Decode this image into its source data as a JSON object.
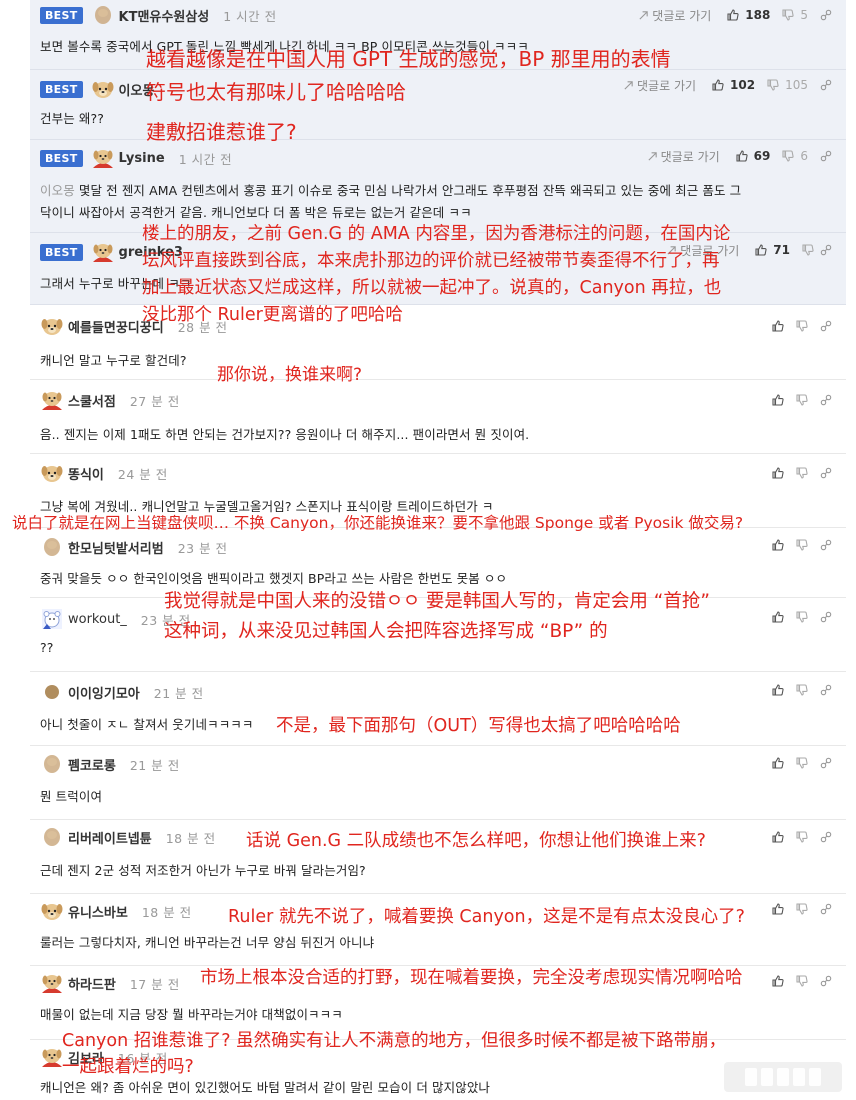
{
  "reply_label": "댓글로 가기",
  "comments": [
    {
      "best": "BEST",
      "nick": "KT맨유수원삼성",
      "time": "1 시간 전",
      "up": "188",
      "down": "5",
      "text": "보면 볼수록 중국에서 GPT 돌린 느낌 빡세게 나긴 하네 ㅋㅋ BP 이모티콘 쓰는것들이 ㅋㅋㅋ"
    },
    {
      "best": "BEST",
      "nick": "이오몽",
      "time": "",
      "up": "102",
      "down": "105",
      "text": "건부는 왜??"
    },
    {
      "best": "BEST",
      "nick": "Lysine",
      "time": "1 시간 전",
      "up": "69",
      "down": "6",
      "mention": "이오몽",
      "text": " 몇달 전 젠지 AMA 컨텐츠에서 홍콩 표기 이슈로 중국 민심 나락가서 안그래도 후푸평점 잔뜩 왜곡되고 있는 중에 최근 폼도 그",
      "text2": "닥이니 싸잡아서 공격한거 같음. 캐니언보다 더 폼 박은 듀로는 없는거 같은데 ㅋㅋ"
    },
    {
      "best": "BEST",
      "nick": "greinke3",
      "time": "",
      "up": "71",
      "down": "",
      "text": "그래서 누구로 바꾸는데 ㅋㅋ"
    },
    {
      "nick": "예를들면꿍디꿍디",
      "time": "28 분 전",
      "text": "캐니언 말고 누구로 할건데?"
    },
    {
      "nick": "스쿨서점",
      "time": "27 분 전",
      "text": "음.. 젠지는 이제 1패도 하면 안되는 건가보지?? 응원이나 더 해주지... 팬이라면서 뭔 짓이여."
    },
    {
      "nick": "똥식이",
      "time": "24 분 전",
      "text": "그냥 복에 겨웠네.. 캐니언말고 누굴델고올거임? 스폰지나 표식이랑 트레이드하던가 ㅋ"
    },
    {
      "nick": "한모님텃밭서리범",
      "time": "23 분 전",
      "text": "중궈 맞을듯 ㅇㅇ 한국인이엇음 밴픽이라고 했겟지 BP라고 쓰는 사람은 한번도 못봄 ㅇㅇ"
    },
    {
      "nick": "workout_",
      "time": "23 분 전",
      "text": "??"
    },
    {
      "nick": "이이잉기모아",
      "time": "21 분 전",
      "text": "아니 첫줄이 ㅈㄴ 찰져서 웃기네ㅋㅋㅋㅋ"
    },
    {
      "nick": "펨코로롱",
      "time": "21 분 전",
      "text": "뭔 트럭이여"
    },
    {
      "nick": "리버레이트넵튠",
      "time": "18 분 전",
      "text": "근데 젠지 2군 성적 저조한거 아닌가 누구로 바꿔 달라는거임?"
    },
    {
      "nick": "유니스바보",
      "time": "18 분 전",
      "text": "룰러는 그렇다치자, 캐니언 바꾸라는건 너무 양심 뒤진거 아니냐"
    },
    {
      "nick": "하라드판",
      "time": "17 분 전",
      "text": "매물이 없는데 지금 당장 뭘 바꾸라는거야 대책없이ㅋㅋㅋ"
    },
    {
      "nick": "김보라",
      "time": "16 분 전",
      "text": "캐니언은 왜? 좀 아쉬운 면이 있긴했어도 바텀 말려서 같이 말린 모습이 더 많지않았나"
    }
  ],
  "overlays": [
    "越看越像是在中国人用 GPT 生成的感觉，BP 那里用的表情",
    "符号也太有那味儿了哈哈哈哈",
    "建敷招谁惹谁了?",
    "楼上的朋友，之前 Gen.G 的 AMA 内容里，因为香港标注的问题，在国内论",
    "坛风评直接跌到谷底，本来虎扑那边的评价就已经被带节奏歪得不行了，再",
    "加上最近状态又烂成这样，所以就被一起冲了。说真的，Canyon 再拉，也",
    "没比那个  Ruler更离谱的了吧哈哈",
    "那你说，换谁来啊?",
    "说白了就是在网上当键盘侠呗… 不换 Canyon，你还能换谁来？要不拿他跟 Sponge 或者 Pyosik 做交易?",
    "我觉得就是中国人来的没错ㅇㅇ 要是韩国人写的，肯定会用  “首抢”",
    "这种词，从来没见过韩国人会把阵容选择写成  “BP”  的",
    "不是，最下面那句（OUT）写得也太搞了吧哈哈哈哈",
    "话说 Gen.G 二队成绩也不怎么样吧，你想让他们换谁上来?",
    "Ruler 就先不说了，喊着要换 Canyon，这是不是有点太没良心了?",
    "市场上根本没合适的打野，现在喊着要换，完全没考虑现实情况啊哈哈",
    "Canyon 招谁惹谁了? 虽然确实有让人不满意的地方，但很多时候不都是被下路带崩，",
    "一起跟着烂的吗?"
  ]
}
